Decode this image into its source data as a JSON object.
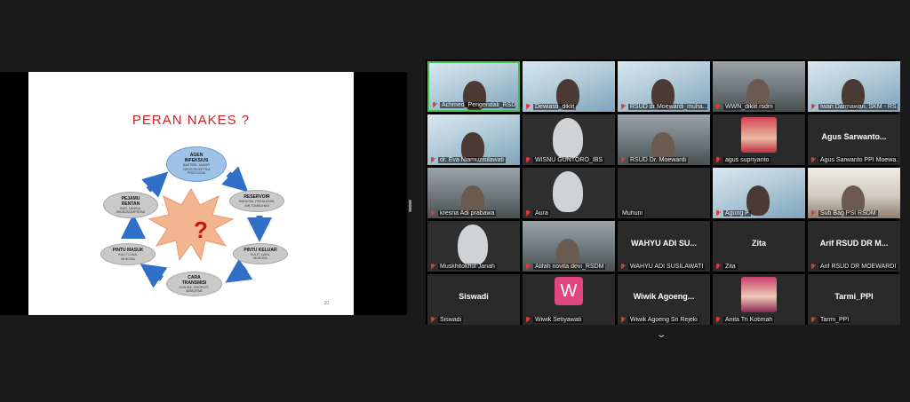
{
  "slide": {
    "title": "PERAN  NAKES  ?",
    "page_number": "10",
    "center": "?",
    "nodes": {
      "agen": {
        "title": "AGEN\nINFEKSIUS",
        "sub": "BAKTERI, JAMUR\nVIRUS,RICKETSIA\nPROTOZOA"
      },
      "reservoir": {
        "title": "RESERVOIR",
        "sub": "MANUSIA, PERALATAN,\nAIR,TUMBUHAN"
      },
      "pintu_keluar": {
        "title": "PINTU KELUAR",
        "sub": "KULIT, LUKA,\nMUKOSA"
      },
      "cara_transmisi": {
        "title": "CARA\nTRANSMISI",
        "sub": "KONTAK, DROPLET,\nAIRBORNE"
      },
      "pintu_masuk": {
        "title": "PINTU MASUK",
        "sub": "KULIT LUKA,\nMUKOSA"
      },
      "pejamu": {
        "title": "PEJAMU\nRENTAN",
        "sub": "BAYI, LANSIA,\nIMUNOKOMPROMI"
      }
    }
  },
  "participants": [
    {
      "caption": "Achmed_Pengendali_RSDM",
      "video": "slide",
      "active": true
    },
    {
      "caption": "Dewiasti_diklit",
      "video": "slide"
    },
    {
      "caption": "RSUD dr Moewardi_muha...",
      "video": "slide"
    },
    {
      "caption": "WWN_diklit rsdm",
      "video": "room"
    },
    {
      "caption": "Iwan Darmawan, SKM - RS...",
      "video": "slide"
    },
    {
      "caption": "dr. Eva Niamuzisilawati",
      "video": "slide"
    },
    {
      "caption": "WISNU GUNTORO_IBS",
      "video": "dark"
    },
    {
      "caption": "RSUD Dr. Moewardi",
      "video": "room"
    },
    {
      "caption": "agus supriyanto",
      "video": "avatar-photo"
    },
    {
      "caption": "Agus Sarwanto PPI Moewa...",
      "center_name": "Agus Sarwanto..."
    },
    {
      "caption": "kresna Adi prabawa",
      "video": "room"
    },
    {
      "caption": "Aura",
      "video": "dark"
    },
    {
      "caption": "Muhuni",
      "video": "none",
      "unmuted": true
    },
    {
      "caption": "Agung P",
      "video": "slide"
    },
    {
      "caption": "Sub Bag PSI RSDM",
      "video": "office"
    },
    {
      "caption": "Muskhitokhul Janah",
      "video": "dark"
    },
    {
      "caption": "Alifah novita devi_RSDM",
      "video": "room"
    },
    {
      "caption": "WAHYU ADI SUSILAWATI",
      "center_name": "WAHYU ADI SU..."
    },
    {
      "caption": "Zita",
      "center_name": "Zita"
    },
    {
      "caption": "Arif RSUD DR MOEWARDI ...",
      "center_name": "Arif RSUD DR M..."
    },
    {
      "caption": "Siswadi",
      "center_name": "Siswadi"
    },
    {
      "caption": "Wiwik Setiyawati",
      "avatar_letter": "W"
    },
    {
      "caption": "Wiwik Agoeng Sri Rejeki",
      "center_name": "Wiwik Agoeng..."
    },
    {
      "caption": "Anita Tri Kotimah",
      "video": "avatar-photo2"
    },
    {
      "caption": "Tarmi_PPI",
      "center_name": "Tarmi_PPI"
    }
  ],
  "icons": {
    "mute": "mic-muted-icon",
    "scroll": "chevron-down-icon"
  },
  "colors": {
    "active_border": "#45c24a",
    "mute": "#e23b3b",
    "avatar_w": "#e0457f",
    "slide_title": "#d21f1f"
  }
}
